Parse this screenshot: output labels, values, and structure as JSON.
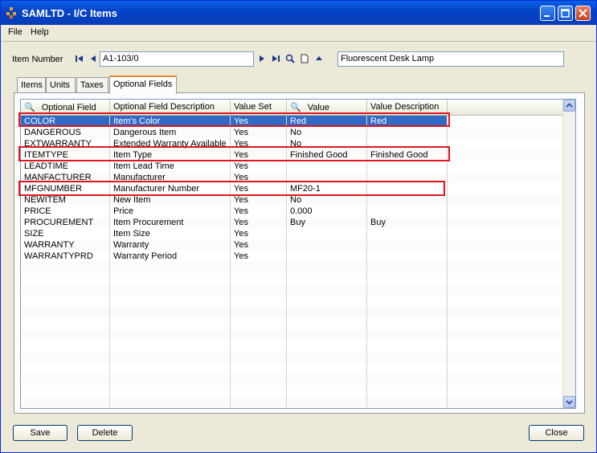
{
  "window": {
    "title": "SAMLTD - I/C Items"
  },
  "menu": {
    "file": "File",
    "help": "Help"
  },
  "item": {
    "label": "Item Number",
    "number": "A1-103/0",
    "description": "Fluorescent Desk Lamp"
  },
  "tabs": [
    "Items",
    "Units",
    "Taxes",
    "Optional Fields"
  ],
  "grid": {
    "columns": [
      "Optional Field",
      "Optional Field Description",
      "Value Set",
      "Value",
      "Value Description"
    ],
    "rows": [
      [
        "COLOR",
        "Item's Color",
        "Yes",
        "Red",
        "Red"
      ],
      [
        "DANGEROUS",
        "Dangerous Item",
        "Yes",
        "No",
        ""
      ],
      [
        "EXTWARRANTY",
        "Extended Warranty Available",
        "Yes",
        "No",
        ""
      ],
      [
        "ITEMTYPE",
        "Item Type",
        "Yes",
        "Finished Good",
        "Finished Good"
      ],
      [
        "LEADTIME",
        "Item Lead Time",
        "Yes",
        "",
        ""
      ],
      [
        "MANFACTURER",
        "Manufacturer",
        "Yes",
        "",
        ""
      ],
      [
        "MFGNUMBER",
        "Manufacturer Number",
        "Yes",
        "MF20-1",
        ""
      ],
      [
        "NEWITEM",
        "New Item",
        "Yes",
        "No",
        ""
      ],
      [
        "PRICE",
        "Price",
        "Yes",
        "0.000",
        ""
      ],
      [
        "PROCUREMENT",
        "Item Procurement",
        "Yes",
        "Buy",
        "Buy"
      ],
      [
        "SIZE",
        "Item Size",
        "Yes",
        "",
        ""
      ],
      [
        "WARRANTY",
        "Warranty",
        "Yes",
        "",
        ""
      ],
      [
        "WARRANTYPRD",
        "Warranty Period",
        "Yes",
        "",
        ""
      ]
    ]
  },
  "buttons": {
    "save": "Save",
    "delete": "Delete",
    "close": "Close"
  }
}
